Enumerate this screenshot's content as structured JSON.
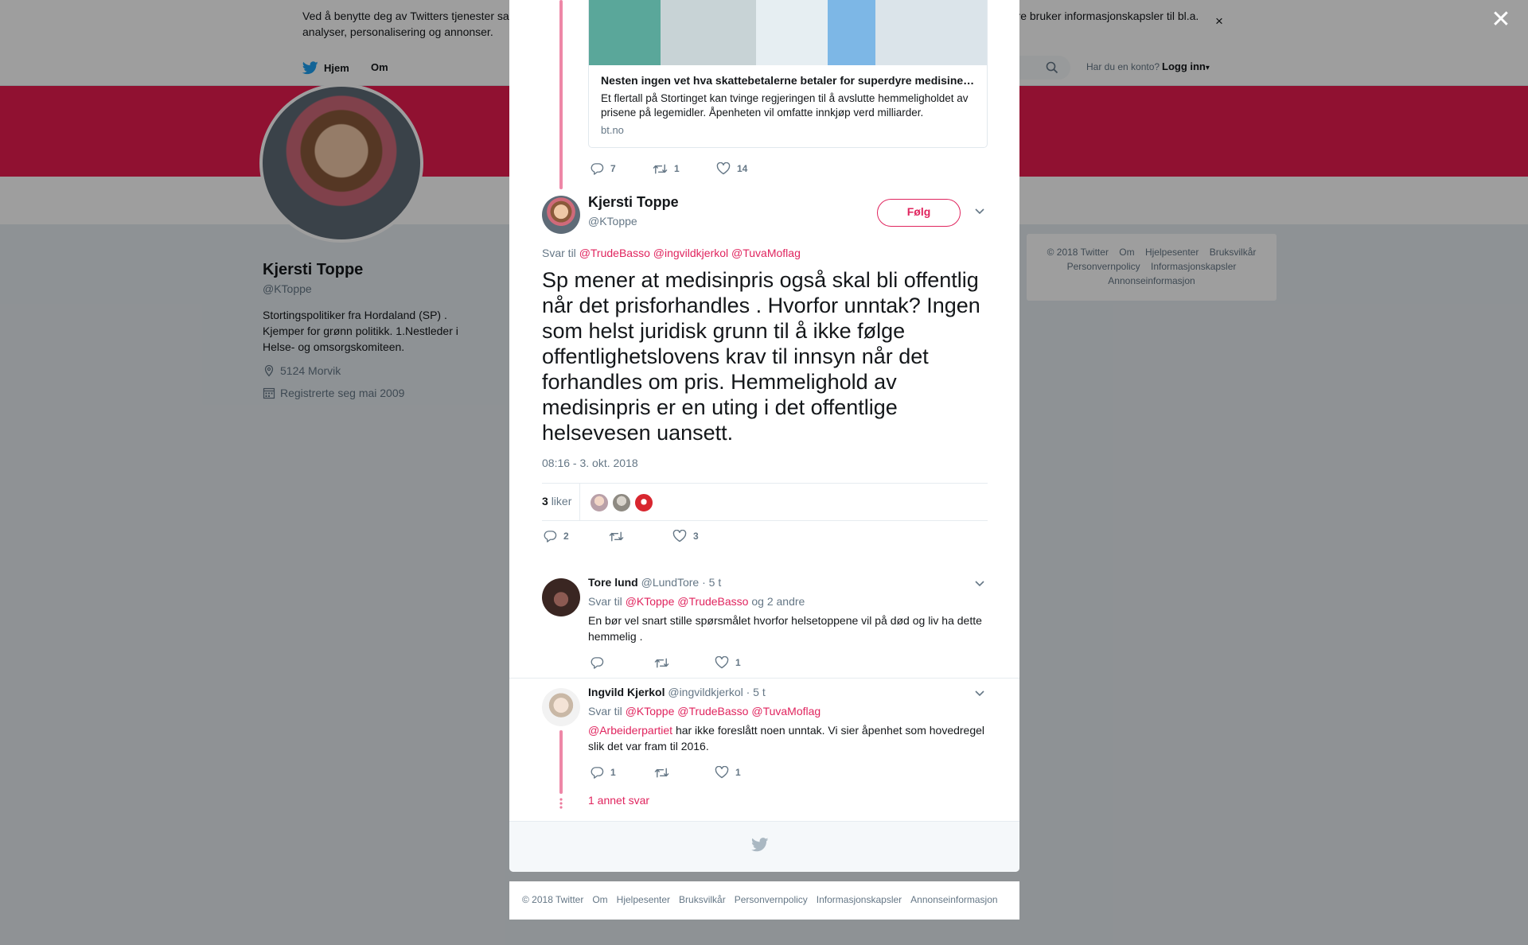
{
  "cookie_bar": {
    "text": "Ved å benytte deg av Twitters tjenester samtykker du i vår bruk av informasjonskapsler og deling av dine data med tredjeparter. Vi og våre partnere bruker informasjonskapsler til bl.a. analyser, personalisering og annonser.",
    "close_symbol": "×"
  },
  "nav": {
    "home": "Hjem",
    "about": "Om",
    "account_question": "Har du en konto?",
    "login": "Logg inn",
    "login_caret": "▾"
  },
  "profile": {
    "name": "Kjersti Toppe",
    "handle": "@KToppe",
    "bio": "Stortingspolitiker fra Hordaland (SP) . Kjemper for grønn politikk. 1.Nestleder i Helse- og omsorgskomiteen.",
    "location": "5124 Morvik",
    "joined": "Registrerte seg mai 2009"
  },
  "side_footer": {
    "links": [
      "© 2018 Twitter",
      "Om",
      "Hjelpesenter",
      "Bruksvilkår",
      "Personvernpolicy",
      "Informasjonskapsler",
      "Annonseinformasjon"
    ]
  },
  "overlay": {
    "close_symbol": "✕"
  },
  "quoted_card": {
    "title": "Nesten ingen vet hva skattebetalerne betaler for superdyre medisiner…",
    "description": "Et flertall på Stortinget kan tvinge regjeringen til å avslutte hemmeligholdet av prisene på legemidler. Åpenheten vil omfatte innkjøp verd milliarder.",
    "domain": "bt.no"
  },
  "parent_actions": {
    "replies": "7",
    "retweets": "1",
    "likes": "14"
  },
  "main_tweet": {
    "name": "Kjersti Toppe",
    "handle": "@KToppe",
    "follow_label": "Følg",
    "reply_prefix": "Svar til",
    "reply_mentions": [
      "@TrudeBasso",
      "@ingvildkjerkol",
      "@TuvaMoflag"
    ],
    "text": "Sp mener at medisinpris også skal bli offentlig når det prisforhandles . Hvorfor unntak? Ingen som helst juridisk grunn til å ikke følge offentlighetslovens krav til innsyn når det forhandles om pris. Hemmelighold av medisinpris er en uting i det offentlige helsevesen uansett.",
    "timestamp": "08:16 - 3. okt. 2018",
    "likes_count": "3",
    "likes_label": "liker",
    "actions": {
      "replies": "2",
      "retweets": "",
      "likes": "3"
    }
  },
  "replies": [
    {
      "name": "Tore lund",
      "handle": "@LundTore",
      "time": "· 5 t",
      "reply_prefix": "Svar til",
      "mentions": [
        "@KToppe",
        "@TrudeBasso"
      ],
      "reply_suffix": "og 2 andre",
      "text": "En bør vel snart stille spørsmålet hvorfor helsetoppene vil på død og liv  ha dette hemmelig .",
      "actions": {
        "replies": "",
        "retweets": "",
        "likes": "1"
      }
    },
    {
      "name": "Ingvild Kjerkol",
      "handle": "@ingvildkjerkol",
      "time": "· 5 t",
      "reply_prefix": "Svar til",
      "mentions": [
        "@KToppe",
        "@TrudeBasso",
        "@TuvaMoflag"
      ],
      "text_mention": "@Arbeiderpartiet",
      "text": "har ikke foreslått noen unntak. Vi sier åpenhet som hovedregel slik det var fram til 2016.",
      "actions": {
        "replies": "1",
        "retweets": "",
        "likes": "1"
      }
    }
  ],
  "more_replies": "1 annet svar",
  "bottom_footer": {
    "links": [
      "© 2018 Twitter",
      "Om",
      "Hjelpesenter",
      "Bruksvilkår",
      "Personvernpolicy",
      "Informasjonskapsler",
      "Annonseinformasjon"
    ]
  },
  "icons": {
    "twitter_bird": "twitter-bird-icon",
    "reply": "reply-icon",
    "retweet": "retweet-icon",
    "like": "heart-icon",
    "chevron": "chevron-down-icon",
    "location": "location-pin-icon",
    "calendar": "calendar-icon",
    "search": "search-icon"
  },
  "colors": {
    "accent": "#e0245e",
    "banner": "#e81c4f",
    "muted": "#657786",
    "background": "#e6ecf0"
  }
}
